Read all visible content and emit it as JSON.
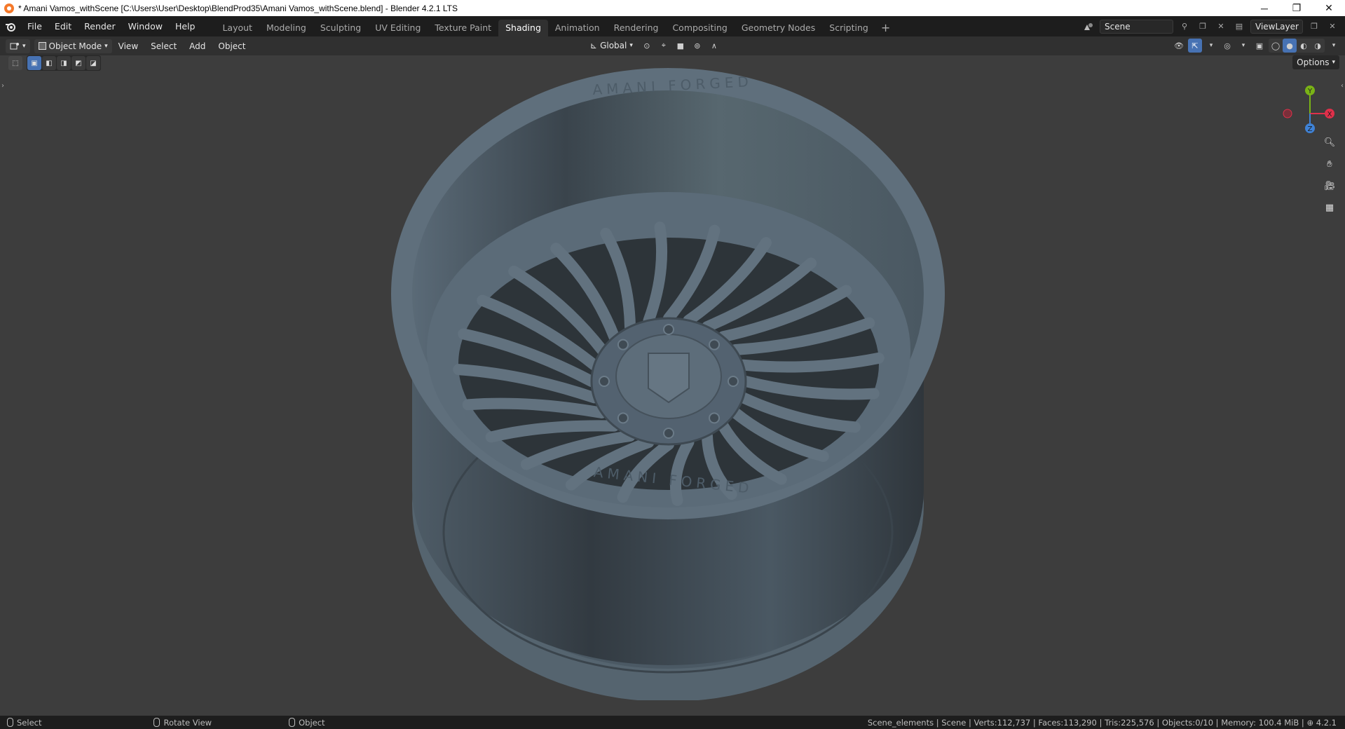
{
  "window": {
    "title": "* Amani Vamos_withScene [C:\\Users\\User\\Desktop\\BlendProd35\\Amani Vamos_withScene.blend] - Blender 4.2.1 LTS",
    "minimize": "─",
    "restore": "❐",
    "close": "✕"
  },
  "menu": {
    "items": [
      "File",
      "Edit",
      "Render",
      "Window",
      "Help"
    ]
  },
  "workspaces": {
    "tabs": [
      "Layout",
      "Modeling",
      "Sculpting",
      "UV Editing",
      "Texture Paint",
      "Shading",
      "Animation",
      "Rendering",
      "Compositing",
      "Geometry Nodes",
      "Scripting"
    ],
    "active": "Shading",
    "add": "+"
  },
  "scene": {
    "name": "Scene",
    "view_layer": "ViewLayer"
  },
  "viewport_header": {
    "mode": "Object Mode",
    "menus": [
      "View",
      "Select",
      "Add",
      "Object"
    ],
    "orientation": "Global"
  },
  "viewport": {
    "options_label": "Options",
    "gizmo": {
      "x": "X",
      "y": "Y",
      "z": "Z"
    },
    "wheel_text_top": "AMANI FORGED",
    "wheel_text_bottom": "AMANI FORGED"
  },
  "statusbar": {
    "select": "Select",
    "rotate": "Rotate View",
    "object": "Object",
    "stats": "Scene_elements | Scene | Verts:112,737 | Faces:113,290 | Tris:225,576 | Objects:0/10 | Memory: 100.4 MiB |",
    "version": "4.2.1"
  },
  "colors": {
    "accent": "#4772b3",
    "active_tab": "#303030",
    "axis_x": "#e0304a",
    "axis_y": "#7ab316",
    "axis_z": "#3f82d6",
    "wheel": "#5b6b78"
  }
}
